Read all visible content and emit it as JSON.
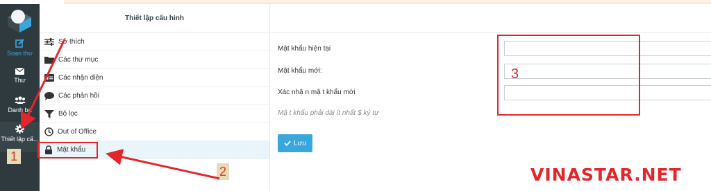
{
  "sidebar": {
    "items": [
      {
        "label": "Soạn thư",
        "icon": "compose-icon"
      },
      {
        "label": "Thư",
        "icon": "envelope-icon"
      },
      {
        "label": "Danh bạ",
        "icon": "contacts-icon"
      },
      {
        "label": "Thiết lập cấ...",
        "icon": "gear-icon"
      }
    ]
  },
  "settings_panel": {
    "title": "Thiết lập cấu hình",
    "items": [
      {
        "label": "Sở thích",
        "icon": "sliders-icon"
      },
      {
        "label": "Các thư mục",
        "icon": "folder-icon"
      },
      {
        "label": "Các nhận diện",
        "icon": "id-card-icon"
      },
      {
        "label": "Các phản hồi",
        "icon": "comment-icon"
      },
      {
        "label": "Bộ lọc",
        "icon": "filter-icon"
      },
      {
        "label": "Out of Office",
        "icon": "clock-icon"
      },
      {
        "label": "Mật khẩu",
        "icon": "lock-icon"
      }
    ]
  },
  "password_form": {
    "current_label": "Mật khẩu hiện tại",
    "new_label": "Mật khẩu mới:",
    "confirm_label": "Xác nhậ n mậ t khẩu mới",
    "hint": "Mậ t khẩu phải dài ít nhất $ ký tự",
    "save_label": "Lưu"
  },
  "annotations": {
    "step1": "1",
    "step2": "2",
    "step3": "3",
    "watermark": "VINASTAR.NET"
  },
  "colors": {
    "sidebar_bg": "#2f3a3f",
    "accent": "#39a7dc",
    "annotation_red": "#e3262c"
  }
}
